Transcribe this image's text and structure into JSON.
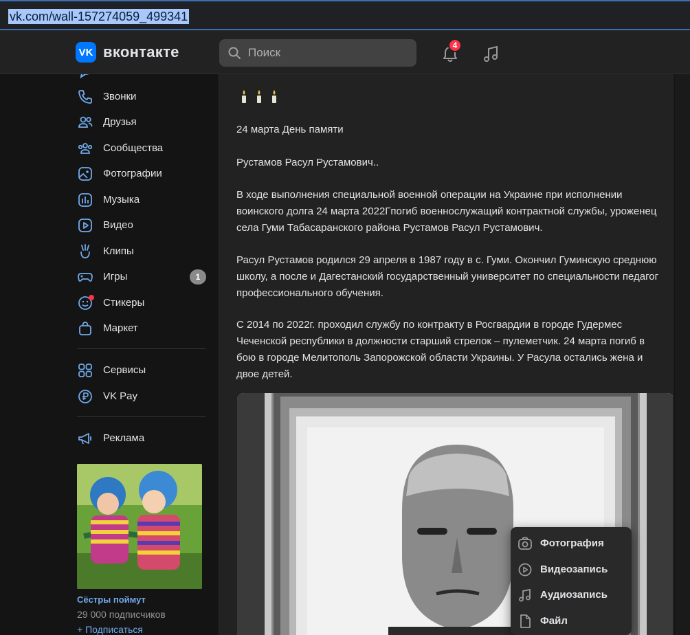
{
  "browser": {
    "url": "vk.com/wall-157274059_499341"
  },
  "header": {
    "logo_mark": "VK",
    "logo_text": "вконтакте",
    "search_placeholder": "Поиск",
    "notifications_count": "4"
  },
  "sidebar": {
    "items": [
      {
        "label": "Звонки",
        "icon": "phone-icon"
      },
      {
        "label": "Друзья",
        "icon": "friends-icon"
      },
      {
        "label": "Сообщества",
        "icon": "communities-icon"
      },
      {
        "label": "Фотографии",
        "icon": "photos-icon"
      },
      {
        "label": "Музыка",
        "icon": "music-icon"
      },
      {
        "label": "Видео",
        "icon": "video-icon"
      },
      {
        "label": "Клипы",
        "icon": "clips-icon"
      },
      {
        "label": "Игры",
        "icon": "games-icon",
        "count": "1"
      },
      {
        "label": "Стикеры",
        "icon": "stickers-icon"
      },
      {
        "label": "Маркет",
        "icon": "market-icon"
      },
      {
        "label": "Сервисы",
        "icon": "services-icon"
      },
      {
        "label": "VK Pay",
        "icon": "vkpay-icon"
      },
      {
        "label": "Реклама",
        "icon": "ads-icon"
      }
    ],
    "promo": {
      "title": "Сёстры поймут",
      "subscribers": "29 000 подписчиков",
      "subscribe": "+ Подписаться"
    }
  },
  "post": {
    "candles": "🕯🕯🕯",
    "paragraphs": [
      "24 марта День памяти",
      "Рустамов Расул Рустамович..",
      "В ходе выполнения специальной военной операции на Украине при исполнении воинского долга 24 марта 2022Гпогиб военнослужащий контрактной службы, уроженец села Гуми Табасаранского района Рустамов Расул Рустамович.",
      "Расул Рустамов родился 29 апреля в 1987 году в с. Гуми. Окончил Гуминскую среднюю школу, а после и Дагестанский государственный университет по специальности педагог профессионального обучения.",
      "С 2014 по 2022г. проходил службу по контракту в Росгвардии в городе Гудермес Чеченской республики в должности старший стрелок – пулеметчик. 24 марта погиб в бою в городе Мелитополь Запорожской области Украины. У Расула остались жена и двое детей."
    ]
  },
  "attach_menu": {
    "items": [
      {
        "label": "Фотография",
        "icon": "camera-icon"
      },
      {
        "label": "Видеозапись",
        "icon": "video-play-icon"
      },
      {
        "label": "Аудиозапись",
        "icon": "music-note-icon"
      },
      {
        "label": "Файл",
        "icon": "file-icon"
      }
    ]
  },
  "colors": {
    "accent": "#0077ff",
    "link": "#71aaeb",
    "badge": "#ff3347",
    "bg": "#141414",
    "panel": "#222222"
  }
}
